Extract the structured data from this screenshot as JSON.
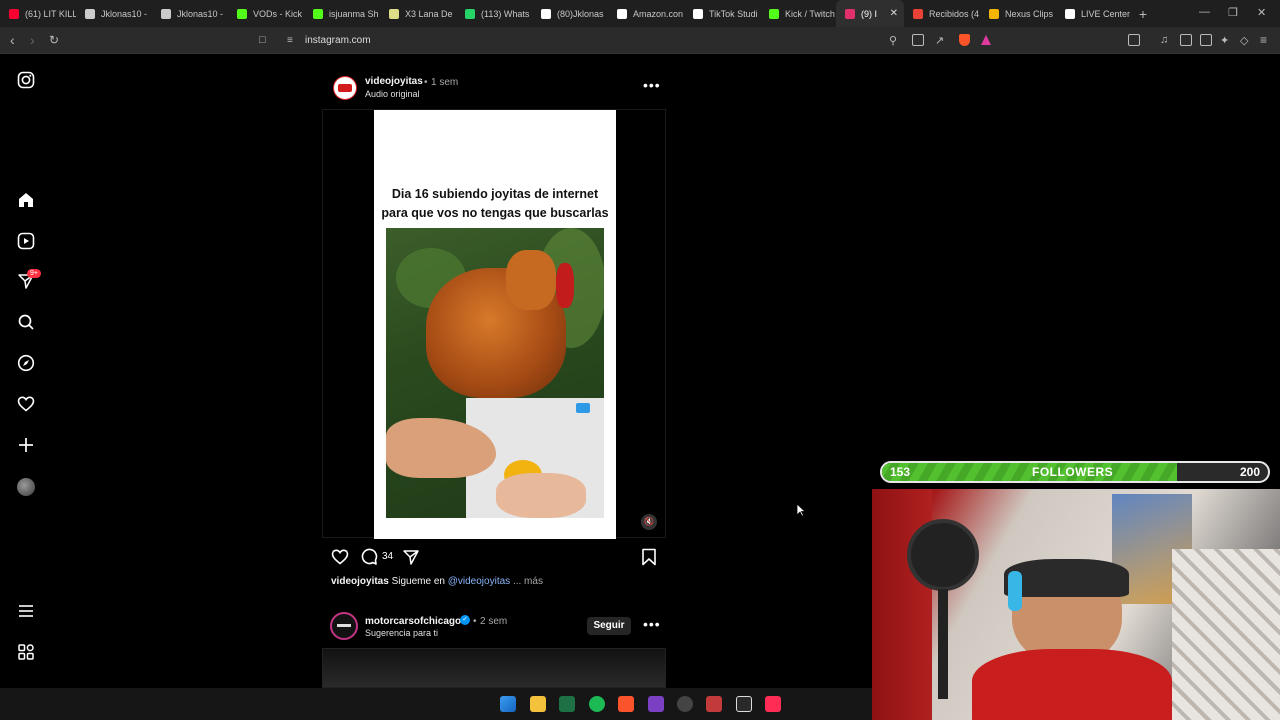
{
  "browser": {
    "tabs": [
      {
        "label": "(61) LIT KILL",
        "color": "#ff0033"
      },
      {
        "label": "Jklonas10 -",
        "color": "#cccccc"
      },
      {
        "label": "Jklonas10 -",
        "color": "#cccccc"
      },
      {
        "label": "VODs - Kick",
        "color": "#53fc18"
      },
      {
        "label": "isjuanma Sh",
        "color": "#53fc18"
      },
      {
        "label": "X3 Lana De",
        "color": "#dddd88"
      },
      {
        "label": "(113) Whats",
        "color": "#25d366"
      },
      {
        "label": "(80)Jklonas",
        "color": "#ffffff"
      },
      {
        "label": "Amazon.con",
        "color": "#ffffff"
      },
      {
        "label": "TikTok Studi",
        "color": "#ffffff"
      },
      {
        "label": "Kick / Twitch",
        "color": "#53fc18"
      },
      {
        "label": "(9) I",
        "color": "#e1306c",
        "active": true
      },
      {
        "label": "Recibidos (4",
        "color": "#ea4335"
      },
      {
        "label": "Nexus Clips",
        "color": "#f4b400"
      },
      {
        "label": "LIVE Center",
        "color": "#ffffff"
      }
    ],
    "url": "instagram.com"
  },
  "post1": {
    "username": "videojoyitas",
    "time": "1 sem",
    "audio": "Audio original",
    "video_title_line1": "Dia 16 subiendo joyitas de internet",
    "video_title_line2": "para que vos no tengas que buscarlas",
    "comment_count": "34",
    "caption_user": "videojoyitas",
    "caption_text": "Sigueme en",
    "caption_mention": "@videojoyitas",
    "caption_more": "... más"
  },
  "post2": {
    "username": "motorcarsofchicago",
    "time": "2 sem",
    "subtitle": "Sugerencia para ti",
    "follow_label": "Seguir"
  },
  "sidebar": {
    "notification_badge": "9+"
  },
  "overlay": {
    "current": "153",
    "label": "FOLLOWERS",
    "goal": "200",
    "progress_fraction": 0.765
  }
}
